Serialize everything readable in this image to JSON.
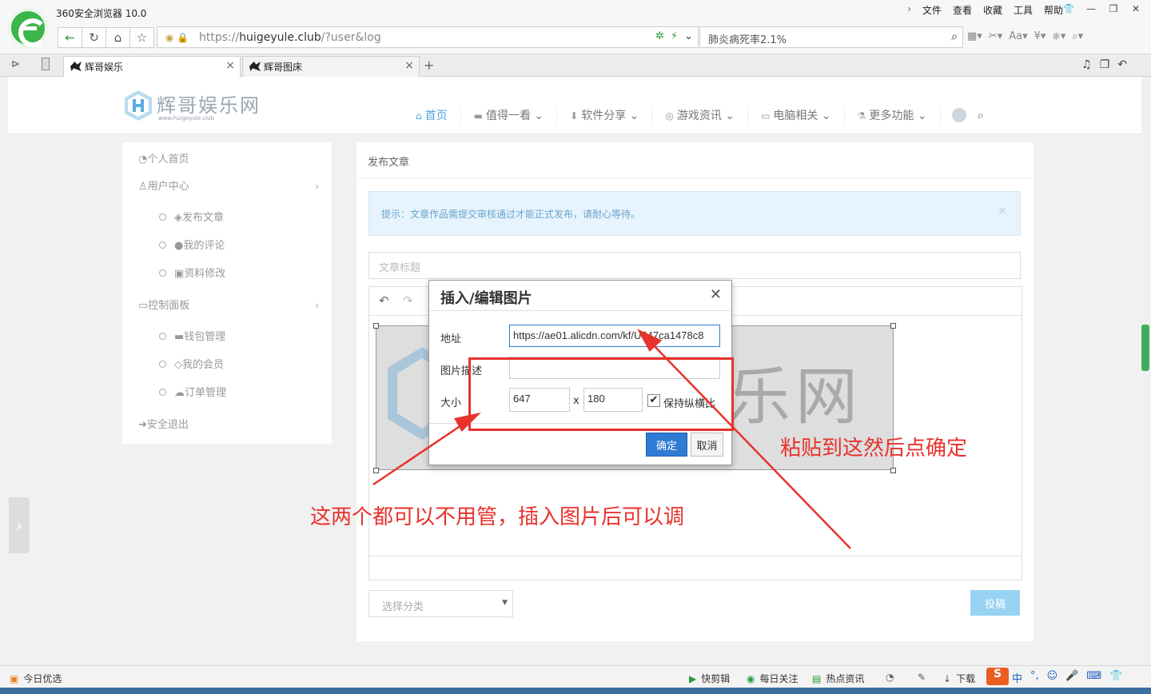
{
  "browser": {
    "title": "360安全浏览器 10.0",
    "menu": [
      "文件",
      "查看",
      "收藏",
      "工具",
      "帮助"
    ],
    "url_scheme": "https://",
    "url_host": "huigeyule.club",
    "url_path": "/?user&log",
    "search_text": "肺炎病死率2.1%",
    "tabs": [
      {
        "label": "辉哥娱乐"
      },
      {
        "label": "辉哥图床"
      }
    ]
  },
  "site": {
    "logo_text": "辉哥娱乐网",
    "logo_sub": "www.huigeyule.club",
    "nav": [
      "首页",
      "值得一看",
      "软件分享",
      "游戏资讯",
      "电脑相关",
      "更多功能"
    ]
  },
  "sidebar": {
    "home": "个人首页",
    "user_center": "用户中心",
    "user_items": [
      "发布文章",
      "我的评论",
      "资料修改"
    ],
    "control_panel": "控制面板",
    "control_items": [
      "钱包管理",
      "我的会员",
      "订单管理"
    ],
    "logout": "安全退出"
  },
  "main": {
    "title": "发布文章",
    "alert": "提示：文章作品需提交审核通过才能正式发布，请耐心等待。",
    "title_placeholder": "文章标题",
    "category_placeholder": "选择分类",
    "submit": "投稿",
    "image_watermark": "乐网"
  },
  "dialog": {
    "title": "插入/编辑图片",
    "address_label": "地址",
    "address_value": "https://ae01.alicdn.com/kf/U547ca1478c8",
    "desc_label": "图片描述",
    "desc_value": "",
    "size_label": "大小",
    "width": "647",
    "x_sep": "x",
    "height": "180",
    "keep_ratio": "保持纵横比",
    "ok": "确定",
    "cancel": "取消"
  },
  "annotations": {
    "paste_hint": "粘贴到这然后点确定",
    "ignore_hint": "这两个都可以不用管，插入图片后可以调",
    "color": "#e8322c"
  },
  "statusbar": {
    "left": "今日优选",
    "items": [
      "快剪辑",
      "每日关注",
      "热点资讯",
      "下载"
    ],
    "ime": "中"
  }
}
